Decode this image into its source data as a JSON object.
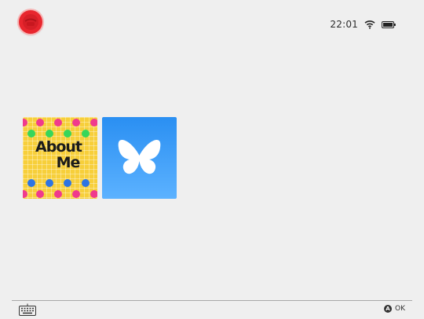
{
  "status": {
    "time": "22:01"
  },
  "tiles": [
    {
      "label_line1": "About",
      "label_line2": "Me",
      "icon": "about-me-tile"
    },
    {
      "icon": "butterfly-icon"
    }
  ],
  "footer": {
    "button_glyph": "A",
    "button_label": "OK",
    "left_icon": "keyboard-icon"
  },
  "colors": {
    "background": "#efefef",
    "avatar": "#e8262e",
    "about_bg": "#f7cf3a",
    "bluesky": "#2a8ff2"
  },
  "icons": [
    "avatar",
    "wifi-icon",
    "battery-icon",
    "butterfly-icon",
    "keyboard-icon",
    "a-button-icon"
  ]
}
